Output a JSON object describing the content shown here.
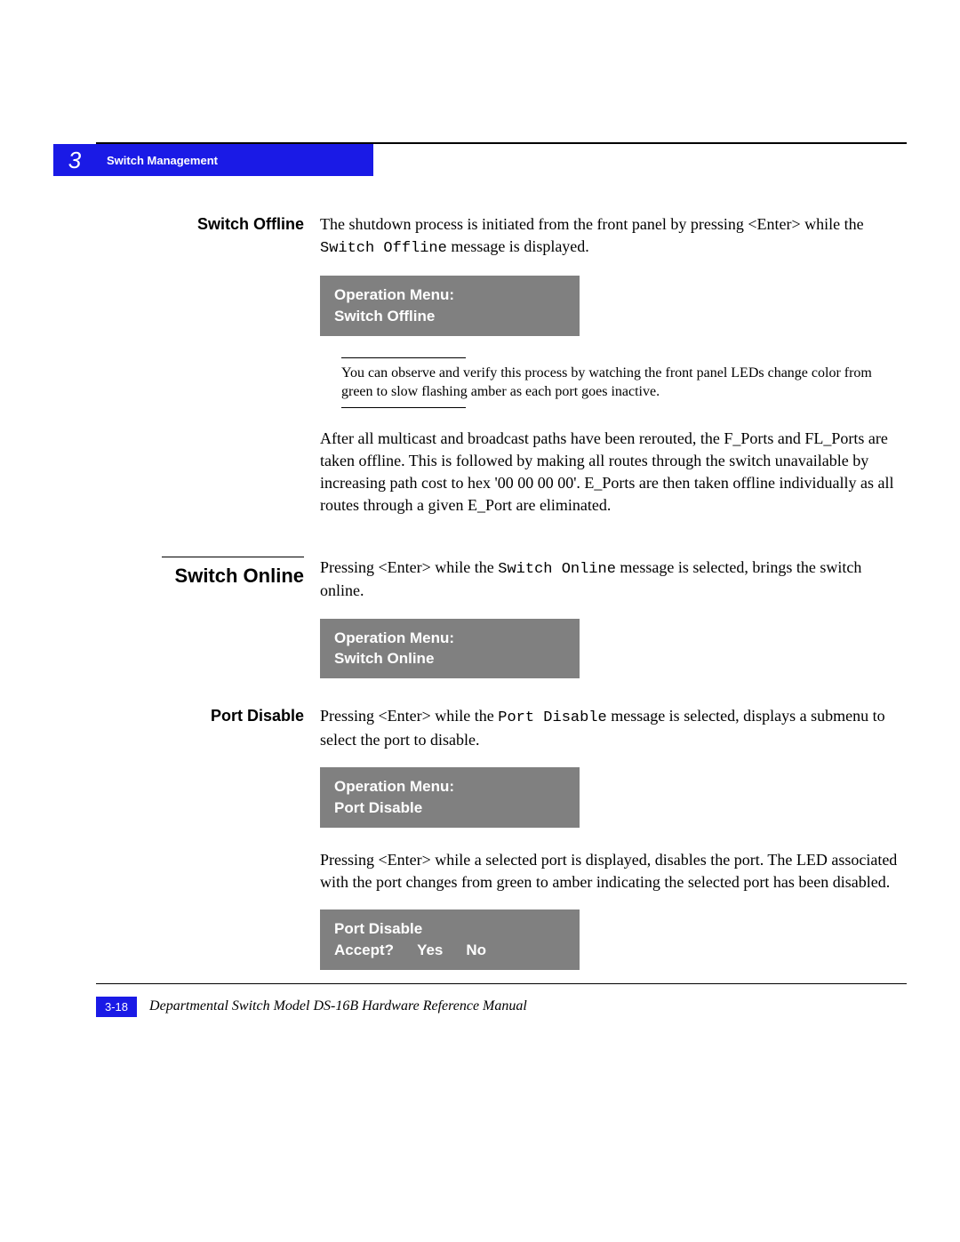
{
  "chapter": {
    "number": "3",
    "title": "Switch Management"
  },
  "sections": {
    "switch_offline": {
      "label": "Switch Offline",
      "para1_a": "The shutdown process is initiated from the front panel by pressing <Enter> while the ",
      "para1_mono": "Switch Offline",
      "para1_b": " message is displayed.",
      "menu_line1": "Operation Menu:",
      "menu_line2": "Switch Offline",
      "note": "You can observe and verify this process by watching the front panel LEDs change color from green to slow flashing amber as each port goes inactive.",
      "para2": "After all multicast and broadcast paths have been rerouted, the F_Ports and FL_Ports are taken offline. This is followed by making all routes through the switch unavailable by increasing path cost to hex '00 00 00 00'. E_Ports are then taken offline individually as all routes through a given E_Port are eliminated."
    },
    "switch_online": {
      "label": "Switch Online",
      "para1_a": "Pressing <Enter> while the ",
      "para1_mono": "Switch Online",
      "para1_b": " message is selected, brings the switch online.",
      "menu_line1": "Operation Menu:",
      "menu_line2": "Switch Online"
    },
    "port_disable": {
      "label": "Port Disable",
      "para1_a": "Pressing <Enter> while the ",
      "para1_mono": "Port Disable",
      "para1_b": " message is selected, displays a submenu to select the port to disable.",
      "menu1_line1": "Operation Menu:",
      "menu1_line2": "Port Disable",
      "para2": "Pressing <Enter> while a selected port is displayed, disables the port. The LED associated with the port changes from green to amber indicating the selected port has been disabled.",
      "menu2_line1": "Port Disable",
      "menu2_accept": "Accept?",
      "menu2_yes": "Yes",
      "menu2_no": "No"
    }
  },
  "footer": {
    "page": "3-18",
    "title": "Departmental Switch Model DS-16B Hardware Reference Manual"
  }
}
